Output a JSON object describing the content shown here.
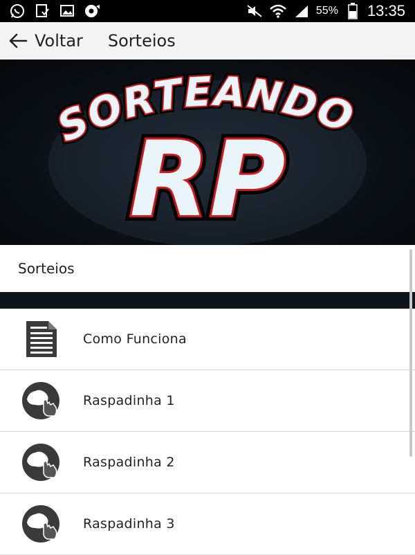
{
  "status_bar": {
    "battery_percent": "55%",
    "time": "13:35",
    "icons": [
      "whatsapp-icon",
      "download-check-icon",
      "gallery-icon",
      "play-store-icon",
      "mute-icon",
      "wifi-icon",
      "signal-icon",
      "battery-icon"
    ]
  },
  "app_bar": {
    "back_label": "Voltar",
    "title": "Sorteios"
  },
  "banner": {
    "logo_top": "SORTEANDO",
    "logo_main": "RP"
  },
  "section": {
    "title": "Sorteios"
  },
  "list": {
    "items": [
      {
        "label": "Como Funciona",
        "icon": "document-icon"
      },
      {
        "label": "Raspadinha 1",
        "icon": "scratch-card-icon"
      },
      {
        "label": "Raspadinha 2",
        "icon": "scratch-card-icon"
      },
      {
        "label": "Raspadinha 3",
        "icon": "scratch-card-icon"
      }
    ]
  },
  "colors": {
    "status_bar": "#000000",
    "app_bar": "#f4f4f4",
    "banner_dark": "#0a0f15",
    "logo_fill": "#e9f4fb",
    "logo_outline": "#d01818",
    "icon_gray": "#3a3a3a"
  }
}
